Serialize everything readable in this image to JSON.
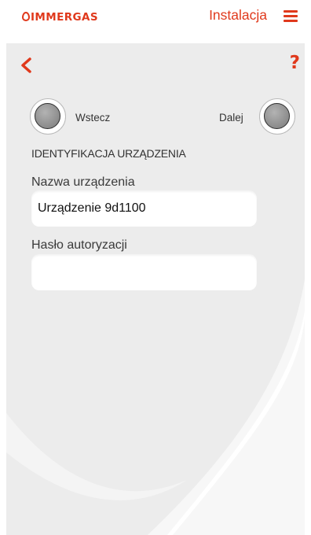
{
  "header": {
    "logo_text": "IMMERGAS",
    "title": "Instalacja",
    "menu_icon": "hamburger-menu-icon"
  },
  "toolbar": {
    "back_icon": "chevron-left-icon",
    "help_icon": "question-mark-icon",
    "help_label": "?"
  },
  "navigation": {
    "prev_label": "Wstecz",
    "next_label": "Dalej"
  },
  "form": {
    "section_title": "IDENTYFIKACJA URZĄDZENIA",
    "device_name_label": "Nazwa urządzenia",
    "device_name_value": "Urządzenie 9d1100",
    "auth_password_label": "Hasło autoryzacji",
    "auth_password_value": ""
  },
  "colors": {
    "accent": "#e0391c",
    "panel_background": "#ececec",
    "header_background": "#ffffff"
  }
}
